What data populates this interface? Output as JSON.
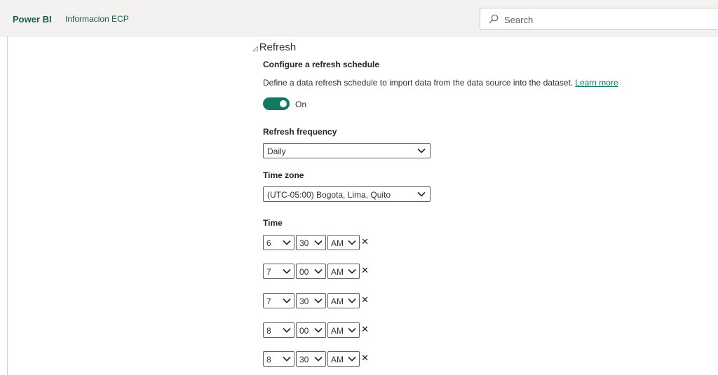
{
  "header": {
    "brand": "Power BI",
    "workspace": "Informacion ECP",
    "search_placeholder": "Search"
  },
  "refresh": {
    "section_title": "Refresh",
    "heading": "Configure a refresh schedule",
    "description": "Define a data refresh schedule to import data from the data source into the dataset.",
    "learn_more": "Learn more",
    "toggle_state": "On",
    "frequency_label": "Refresh frequency",
    "frequency_value": "Daily",
    "timezone_label": "Time zone",
    "timezone_value": "(UTC-05:00) Bogota, Lima, Quito",
    "time_label": "Time",
    "times": [
      {
        "hour": "6",
        "minute": "30",
        "ampm": "AM"
      },
      {
        "hour": "7",
        "minute": "00",
        "ampm": "AM"
      },
      {
        "hour": "7",
        "minute": "30",
        "ampm": "AM"
      },
      {
        "hour": "8",
        "minute": "00",
        "ampm": "AM"
      },
      {
        "hour": "8",
        "minute": "30",
        "ampm": "AM"
      }
    ],
    "remove_glyph": "✕"
  },
  "colors": {
    "brand": "#1d5c4d",
    "accent": "#117865"
  }
}
